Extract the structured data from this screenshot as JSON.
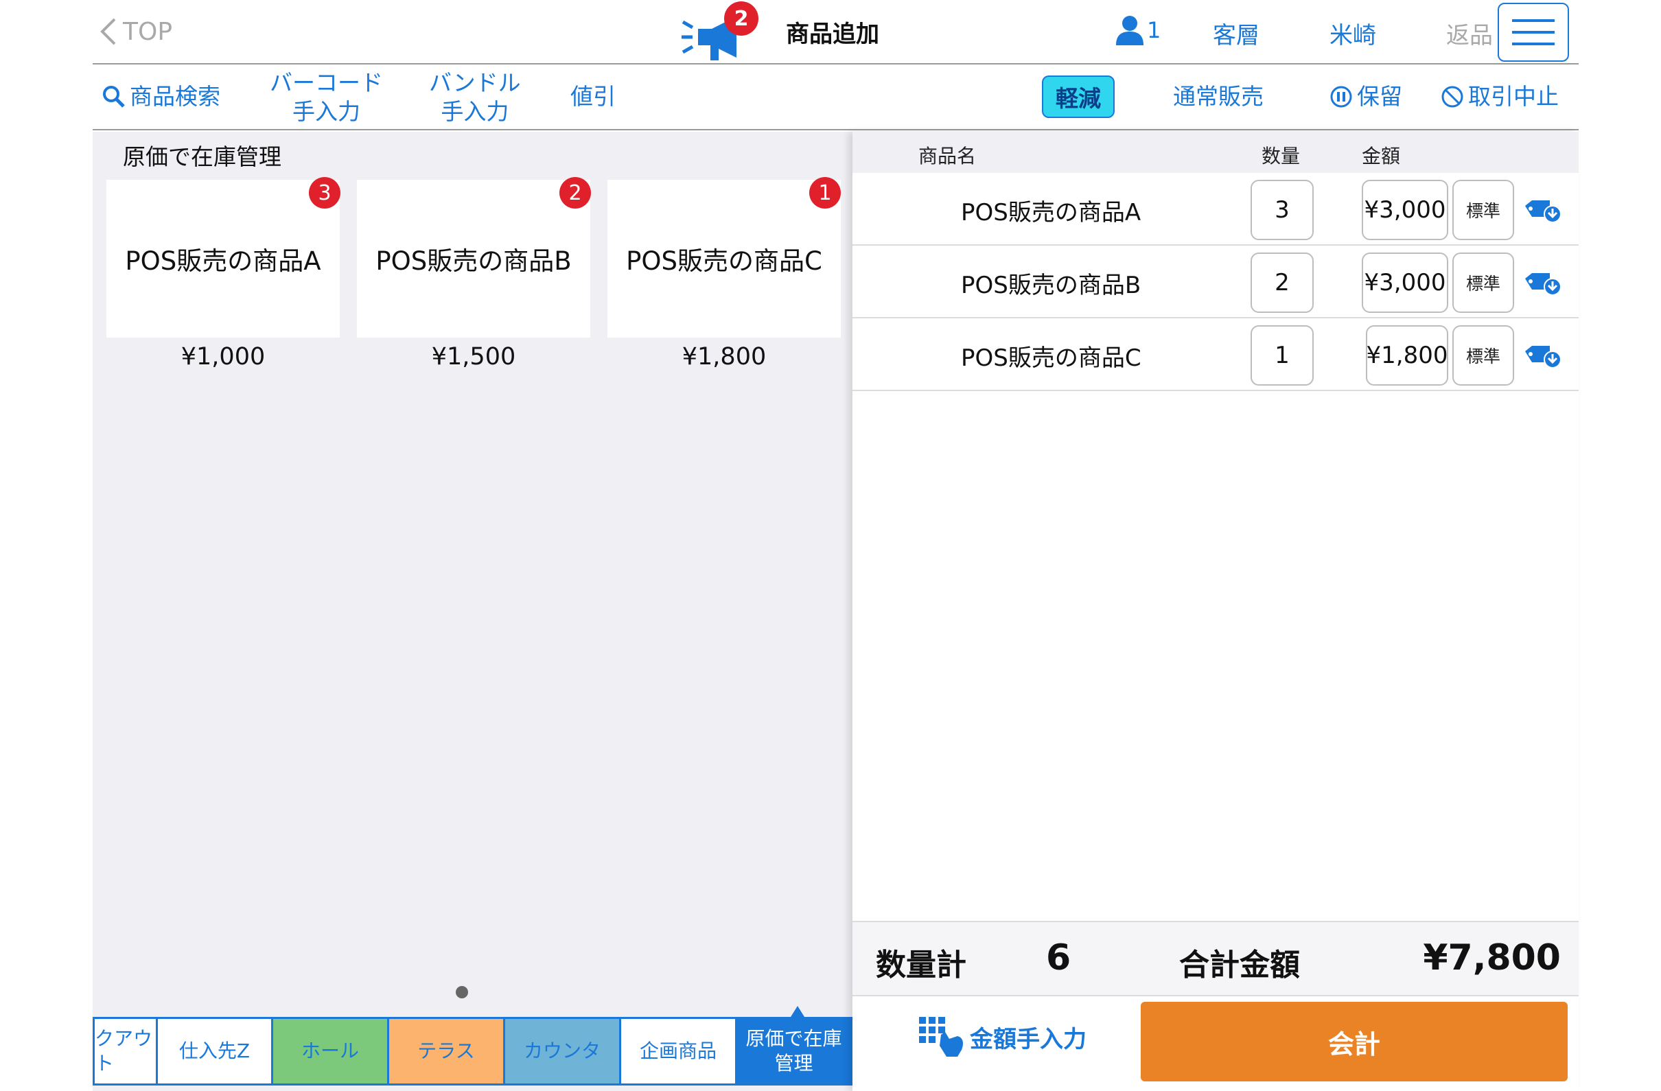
{
  "header": {
    "back_label": "TOP",
    "notification_count": "2",
    "title": "商品追加",
    "user_count": "1",
    "links": [
      "客層",
      "米崎",
      "返品"
    ]
  },
  "toolbar": {
    "search": "商品検索",
    "barcode_line1": "バーコード",
    "barcode_line2": "手入力",
    "bundle_line1": "バンドル",
    "bundle_line2": "手入力",
    "discount": "値引",
    "keigen": "軽減",
    "normal_sale": "通常販売",
    "hold": "保留",
    "cancel": "取引中止"
  },
  "category": {
    "title": "原価で在庫管理",
    "products": [
      {
        "name": "POS販売の商品A",
        "price": "¥1,000",
        "count": "3"
      },
      {
        "name": "POS販売の商品B",
        "price": "¥1,500",
        "count": "2"
      },
      {
        "name": "POS販売の商品C",
        "price": "¥1,800",
        "count": "1"
      }
    ],
    "tabs": [
      {
        "line1": "クアウ",
        "line2": "ト",
        "color": "#ffffff"
      },
      {
        "line1": "仕入先Z",
        "line2": "",
        "color": "#ffffff"
      },
      {
        "line1": "ホール",
        "line2": "",
        "color": "#7dc97b"
      },
      {
        "line1": "テラス",
        "line2": "",
        "color": "#fbb36d"
      },
      {
        "line1": "カウンタ",
        "line2": "",
        "color": "#6fb3d6"
      },
      {
        "line1": "企画商品",
        "line2": "",
        "color": "#ffffff"
      },
      {
        "line1": "原価で在庫",
        "line2": "管理",
        "color": "#1a78d8"
      }
    ]
  },
  "cart": {
    "headers": {
      "name": "商品名",
      "qty": "数量",
      "amount": "金額"
    },
    "rows": [
      {
        "name": "POS販売の商品A",
        "qty": "3",
        "amount": "¥3,000",
        "price_type": "標準"
      },
      {
        "name": "POS販売の商品B",
        "qty": "2",
        "amount": "¥3,000",
        "price_type": "標準"
      },
      {
        "name": "POS販売の商品C",
        "qty": "1",
        "amount": "¥1,800",
        "price_type": "標準"
      }
    ],
    "qty_total_label": "数量計",
    "qty_total": "6",
    "amount_total_label": "合計金額",
    "amount_total": "¥7,800",
    "manual_amount": "金額手入力",
    "checkout": "会計"
  },
  "colors": {
    "accent": "#1a78d8",
    "badge": "#e0202a",
    "checkout": "#e98325",
    "keigen": "#2fd6ee"
  }
}
